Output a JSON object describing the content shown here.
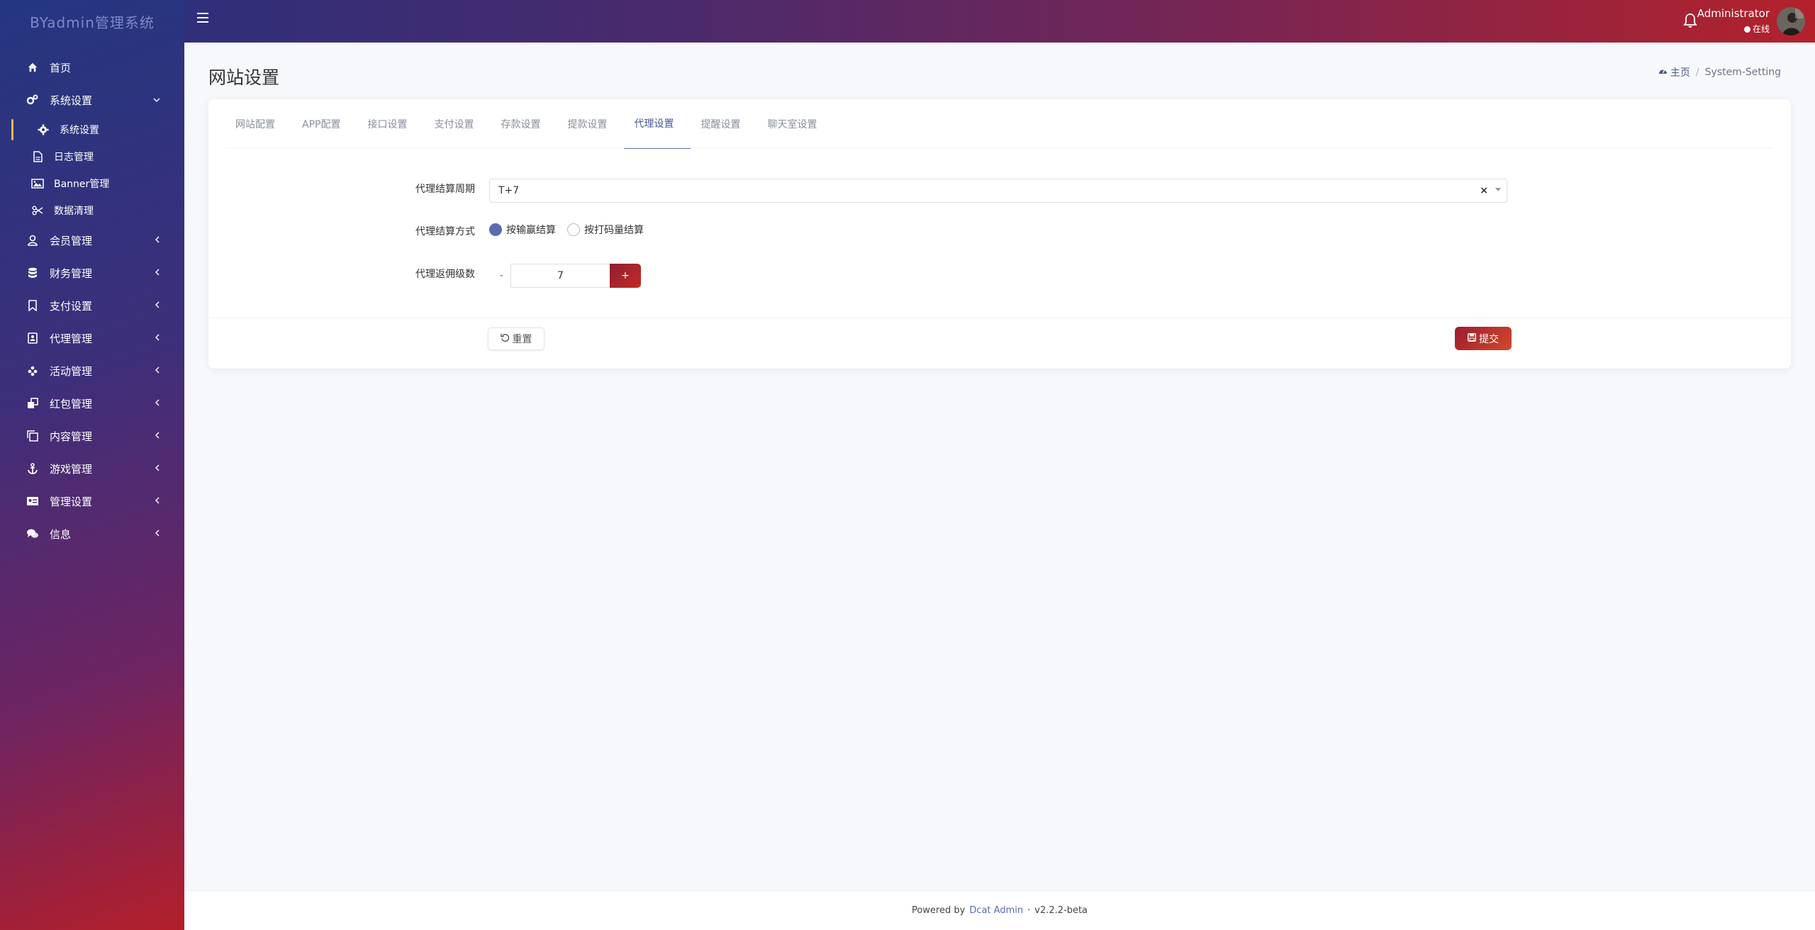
{
  "brand": "BYadmin管理系统",
  "sidebar": {
    "items": [
      {
        "label": "首页",
        "icon": "home-icon",
        "arrow": ""
      },
      {
        "label": "系统设置",
        "icon": "cogs-icon",
        "arrow": "⌄"
      },
      {
        "label": "会员管理",
        "icon": "user-icon",
        "arrow": "‹"
      },
      {
        "label": "财务管理",
        "icon": "database-icon",
        "arrow": "‹"
      },
      {
        "label": "支付设置",
        "icon": "bookmark-icon",
        "arrow": "‹"
      },
      {
        "label": "代理管理",
        "icon": "address-book-icon",
        "arrow": "‹"
      },
      {
        "label": "活动管理",
        "icon": "flower-icon",
        "arrow": "‹"
      },
      {
        "label": "红包管理",
        "icon": "clone-icon",
        "arrow": "‹"
      },
      {
        "label": "内容管理",
        "icon": "copy-icon",
        "arrow": "‹"
      },
      {
        "label": "游戏管理",
        "icon": "anchor-icon",
        "arrow": "‹"
      },
      {
        "label": "管理设置",
        "icon": "id-card-icon",
        "arrow": "‹"
      },
      {
        "label": "信息",
        "icon": "comments-icon",
        "arrow": "‹"
      }
    ],
    "subitems": [
      {
        "label": "系统设置",
        "icon": "gear-icon"
      },
      {
        "label": "日志管理",
        "icon": "file-icon"
      },
      {
        "label": "Banner管理",
        "icon": "image-icon"
      },
      {
        "label": "数据清理",
        "icon": "scissors-icon"
      }
    ]
  },
  "topbar": {
    "user_name": "Administrator",
    "user_status": "在线"
  },
  "page": {
    "title": "网站设置",
    "breadcrumb_home": "主页",
    "breadcrumb_current": "System-Setting"
  },
  "tabs": [
    {
      "label": "网站配置"
    },
    {
      "label": "APP配置"
    },
    {
      "label": "接口设置"
    },
    {
      "label": "支付设置"
    },
    {
      "label": "存款设置"
    },
    {
      "label": "提款设置"
    },
    {
      "label": "代理设置"
    },
    {
      "label": "提醒设置"
    },
    {
      "label": "聊天室设置"
    }
  ],
  "form": {
    "settle_cycle_label": "代理结算周期",
    "settle_cycle_value": "T+7",
    "settle_method_label": "代理结算方式",
    "settle_method_options": [
      "按输赢结算",
      "按打码量结算"
    ],
    "rebate_levels_label": "代理返佣级数",
    "rebate_levels_value": "7",
    "minus": "-",
    "plus": "+",
    "reset_label": "重置",
    "submit_label": "提交"
  },
  "footer": {
    "powered_by": "Powered by",
    "link": "Dcat Admin",
    "dot": "·",
    "version": "v2.2.2-beta"
  }
}
